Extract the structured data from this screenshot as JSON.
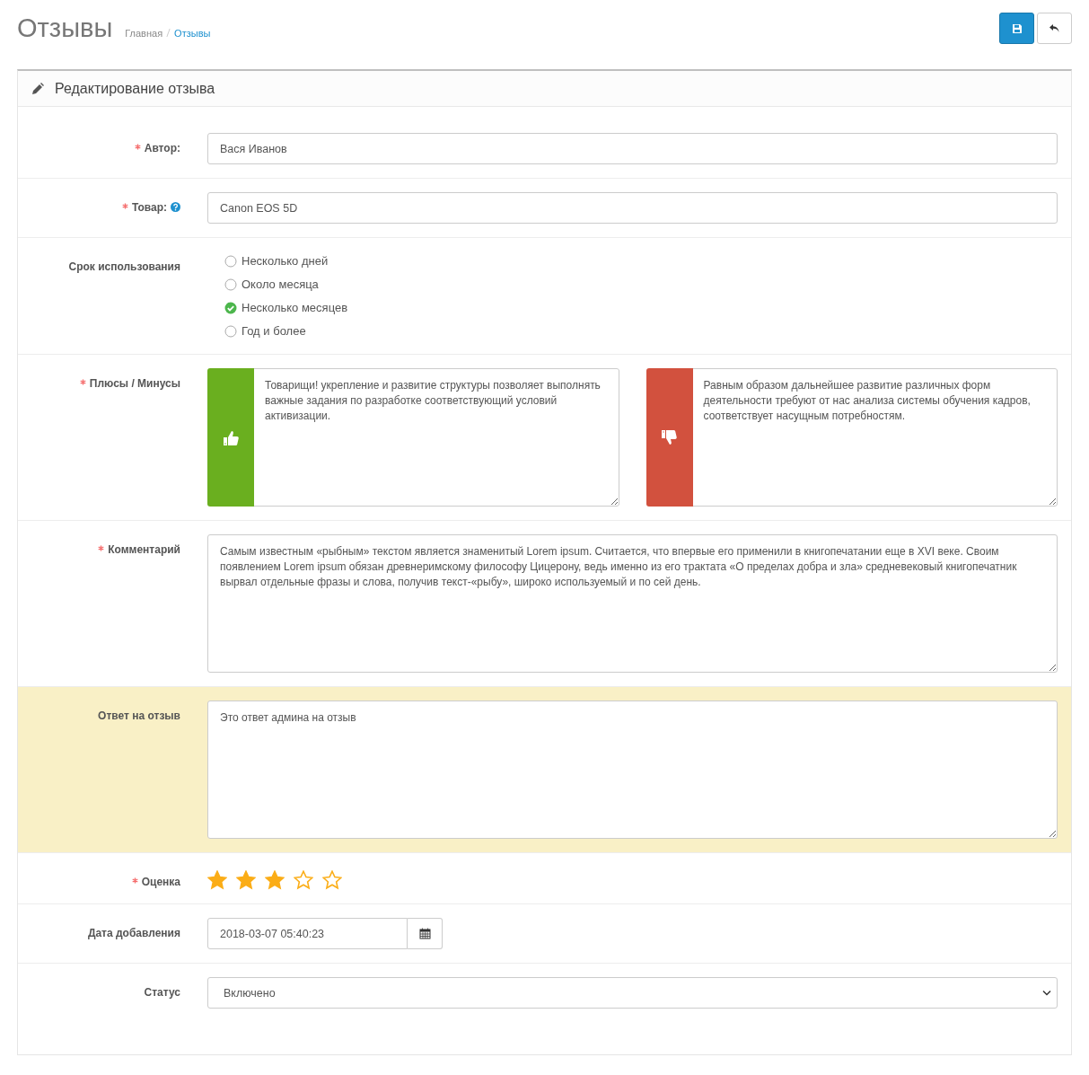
{
  "page": {
    "title": "Отзывы",
    "breadcrumbs": [
      {
        "label": "Главная",
        "current": false
      },
      {
        "label": "Отзывы",
        "current": true
      }
    ]
  },
  "panel": {
    "title": "Редактирование отзыва"
  },
  "fields": [
    {
      "kind": "text",
      "label": "Автор:",
      "required": true,
      "help": false,
      "highlighted": false,
      "value": "Вася Иванов"
    },
    {
      "kind": "text",
      "label": "Товар:",
      "required": true,
      "help": true,
      "highlighted": false,
      "value": "Canon EOS 5D"
    },
    {
      "kind": "radio",
      "label": "Срок использования",
      "required": false,
      "help": false,
      "highlighted": false,
      "options": [
        {
          "label": "Несколько дней",
          "selected": false
        },
        {
          "label": "Около месяца",
          "selected": false
        },
        {
          "label": "Несколько месяцев",
          "selected": true
        },
        {
          "label": "Год и более",
          "selected": false
        }
      ]
    },
    {
      "kind": "proscons",
      "label": "Плюсы / Минусы",
      "required": true,
      "help": false,
      "highlighted": false,
      "pros": "Товарищи! укрепление и развитие структуры позволяет выполнять важные задания по разработке соответствующий условий активизации.",
      "cons": "Равным образом дальнейшее развитие различных форм деятельности требуют от нас анализа системы обучения кадров, соответствует насущным потребностям."
    },
    {
      "kind": "textarea",
      "label": "Комментарий",
      "required": true,
      "help": false,
      "highlighted": false,
      "value": "Самым известным «рыбным» текстом является знаменитый Lorem ipsum. Считается, что впервые его применили в книгопечатании еще в XVI веке. Своим появлением Lorem ipsum обязан древнеримскому философу Цицерону, ведь именно из его трактата «О пределах добра и зла» средневековый книгопечатник вырвал отдельные фразы и слова, получив текст-«рыбу», широко используемый и по сей день."
    },
    {
      "kind": "textarea",
      "label": "Ответ на отзыв",
      "required": false,
      "help": false,
      "highlighted": true,
      "value": "Это ответ админа на отзыв"
    },
    {
      "kind": "stars",
      "label": "Оценка",
      "required": true,
      "help": false,
      "highlighted": false,
      "stars": 3
    },
    {
      "kind": "date",
      "label": "Дата добавления",
      "required": false,
      "help": false,
      "highlighted": false,
      "value": "2018-03-07 05:40:23"
    },
    {
      "kind": "select",
      "label": "Статус",
      "required": false,
      "help": false,
      "highlighted": false,
      "value": "Включено"
    }
  ]
}
